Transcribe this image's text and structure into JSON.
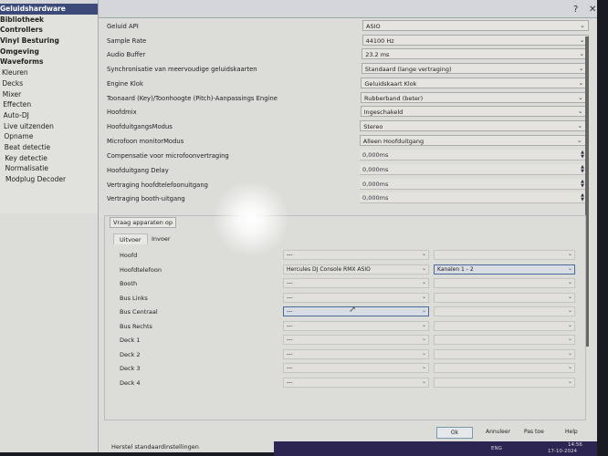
{
  "window": {
    "help": "?",
    "close": "✕"
  },
  "sidebar": {
    "items": [
      {
        "label": "Geluidshardware",
        "selected": true
      },
      {
        "label": "Bibliotheek"
      },
      {
        "label": "Controllers"
      },
      {
        "label": "Vinyl Besturing"
      },
      {
        "label": "Omgeving"
      },
      {
        "label": "Waveforms"
      },
      {
        "label": "Kleuren"
      },
      {
        "label": "Decks"
      },
      {
        "label": "Mixer"
      },
      {
        "label": "Effecten"
      },
      {
        "label": "Auto-DJ"
      },
      {
        "label": "Live uitzenden"
      },
      {
        "label": "Opname"
      },
      {
        "label": "Beat detectie"
      },
      {
        "label": "Key detectie"
      },
      {
        "label": "Normalisatie"
      },
      {
        "label": "Modplug Decoder"
      }
    ]
  },
  "settings": [
    {
      "label": "Geluid API",
      "value": "ASIO"
    },
    {
      "label": "Sample Rate",
      "value": "44100 Hz"
    },
    {
      "label": "Audio Buffer",
      "value": "23.2 ms"
    },
    {
      "label": "Synchronisatie van meervoudige geluidskaarten",
      "value": "Standaard (lange vertraging)"
    },
    {
      "label": "Engine Klok",
      "value": "Geluidskaart Klok"
    },
    {
      "label": "Toonaard (Key)/Toonhoogte (Pitch)-Aanpassings Engine",
      "value": "Rubberband (beter)"
    },
    {
      "label": "Hoofdmix",
      "value": "Ingeschakeld"
    },
    {
      "label": "HoofduitgangsModus",
      "value": "Stereo"
    },
    {
      "label": "Microfoon monitorModus",
      "value": "Alleen Hoofduitgang"
    }
  ],
  "delays": [
    {
      "label": "Compensatie voor microfoonvertraging",
      "value": "0,000ms"
    },
    {
      "label": "Hoofduitgang Delay",
      "value": "0,000ms"
    },
    {
      "label": "Vertraging hoofdtelefoonuitgang",
      "value": "0,000ms"
    },
    {
      "label": "Vertraging booth-uitgang",
      "value": "0,000ms"
    }
  ],
  "query_button": "Vraag apparaten op",
  "tabs": [
    "Uitvoer",
    "Invoer"
  ],
  "outputs": [
    {
      "label": "Hoofd",
      "device": "---",
      "channels": ""
    },
    {
      "label": "Hoofdtelefoon",
      "device": "Hercules DJ Console RMX ASIO",
      "channels": "Kanalen 1 - 2"
    },
    {
      "label": "Booth",
      "device": "---",
      "channels": ""
    },
    {
      "label": "Bus Links",
      "device": "---",
      "channels": ""
    },
    {
      "label": "Bus Centraal",
      "device": "---",
      "channels": ""
    },
    {
      "label": "Bus Rechts",
      "device": "---",
      "channels": ""
    },
    {
      "label": "Deck 1",
      "device": "---",
      "channels": ""
    },
    {
      "label": "Deck 2",
      "device": "---",
      "channels": ""
    },
    {
      "label": "Deck 3",
      "device": "---",
      "channels": ""
    },
    {
      "label": "Deck 4",
      "device": "---",
      "channels": ""
    }
  ],
  "buttons": {
    "ok": "Ok",
    "cancel": "Annuleer",
    "apply": "Pas toe",
    "help": "Help"
  },
  "status": "Herstel standaardinstellingen",
  "taskbar": {
    "lang": "ENG",
    "time": "14:56",
    "date": "17-10-2024"
  }
}
